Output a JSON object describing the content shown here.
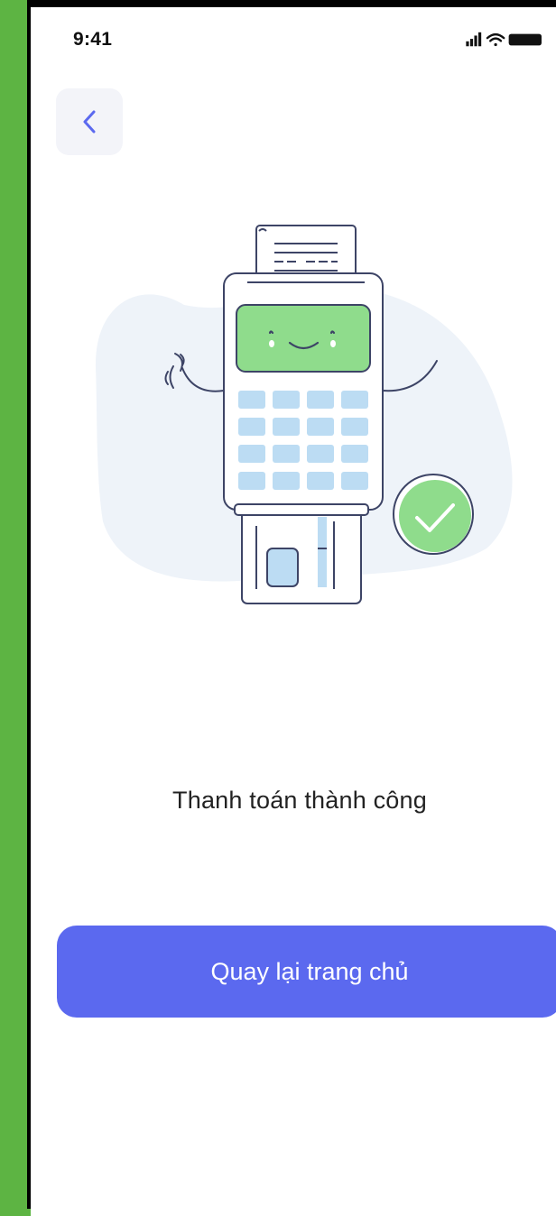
{
  "status_bar": {
    "time": "9:41"
  },
  "header": {
    "back_icon": "chevron-left-icon"
  },
  "main": {
    "title": "Thanh toán thành công"
  },
  "actions": {
    "home_button_label": "Quay lại trang chủ"
  },
  "colors": {
    "accent": "#5b69ef",
    "success": "#8fdc8c",
    "keypad": "#bcdcf3",
    "blob": "#eef3f9",
    "outline": "#3d4466"
  }
}
